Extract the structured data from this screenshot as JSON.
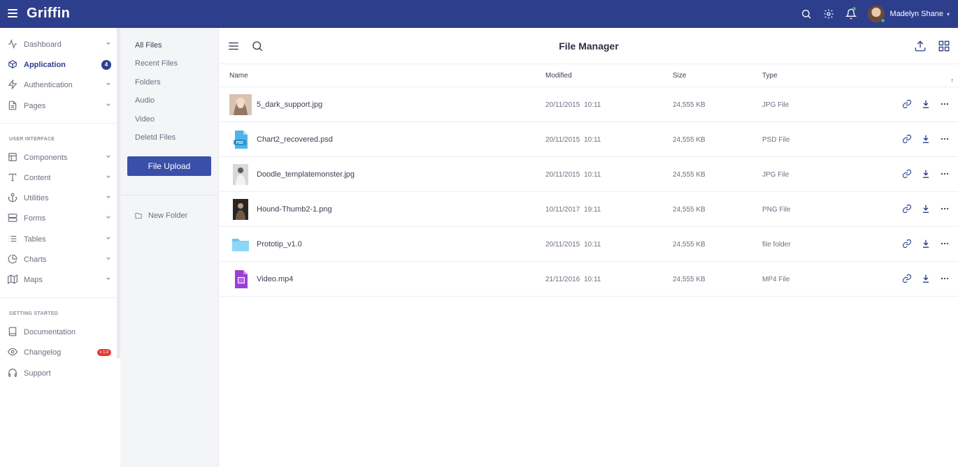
{
  "app": {
    "brand": "Griffin",
    "accent": "#2d3e8c"
  },
  "topbar": {
    "icons": [
      "search-icon",
      "gear-icon",
      "bell-icon"
    ],
    "user_name": "Madelyn Shane"
  },
  "sidebar": {
    "items_main": [
      {
        "label": "Dashboard",
        "icon": "activity-icon",
        "expandable": true
      },
      {
        "label": "Application",
        "icon": "box-icon",
        "badge": "4",
        "active": true
      },
      {
        "label": "Authentication",
        "icon": "zap-icon",
        "expandable": true
      },
      {
        "label": "Pages",
        "icon": "file-icon",
        "expandable": true
      }
    ],
    "section_ui": "USER INTERFACE",
    "items_ui": [
      {
        "label": "Components",
        "icon": "layout-icon"
      },
      {
        "label": "Content",
        "icon": "type-icon"
      },
      {
        "label": "Utilities",
        "icon": "anchor-icon"
      },
      {
        "label": "Forms",
        "icon": "server-icon"
      },
      {
        "label": "Tables",
        "icon": "list-icon"
      },
      {
        "label": "Charts",
        "icon": "pie-chart-icon"
      },
      {
        "label": "Maps",
        "icon": "map-icon"
      }
    ],
    "section_start": "GETTING STARTED",
    "items_start": [
      {
        "label": "Documentation",
        "icon": "book-icon"
      },
      {
        "label": "Changelog",
        "icon": "eye-icon",
        "badge": "v 1.0"
      },
      {
        "label": "Support",
        "icon": "headphones-icon"
      }
    ]
  },
  "files_panel": {
    "links": [
      "All Files",
      "Recent Files",
      "Folders",
      "Audio",
      "Video",
      "Deletd Files"
    ],
    "upload_label": "File Upload",
    "new_folder_label": "New Folder"
  },
  "main": {
    "title": "File Manager",
    "columns": [
      "Name",
      "Modified",
      "Size",
      "Type"
    ],
    "sort_indicator": "↑",
    "files": [
      {
        "name": "5_dark_support.jpg",
        "date": "20/11/2015 10:11",
        "size": "24,555 KB",
        "type": "JPG File",
        "thumb": "photo-woman"
      },
      {
        "name": "Chart2_recovered.psd",
        "date": "20/11/2015 10:11",
        "size": "24,555 KB",
        "type": "PSD File",
        "thumb": "psd-file-icon",
        "thumb_label": "PSD"
      },
      {
        "name": "Doodle_templatemonster.jpg",
        "date": "20/11/2015 10:11",
        "size": "24,555 KB",
        "type": "JPG File",
        "thumb": "photo-man"
      },
      {
        "name": "Hound-Thumb2-1.png",
        "date": "10/11/2017 19:11",
        "size": "24,555 KB",
        "type": "PNG File",
        "thumb": "photo-dark"
      },
      {
        "name": "Prototip_v1.0",
        "date": "20/11/2015 10:11",
        "size": "24,555 KB",
        "type": "file folder",
        "thumb": "folder-icon"
      },
      {
        "name": "Video.mp4",
        "date": "21/11/2016 10:11",
        "size": "24,555 KB",
        "type": "MP4 File",
        "thumb": "video-file-icon"
      }
    ],
    "row_actions": [
      "link-icon",
      "download-icon",
      "more-icon"
    ]
  }
}
